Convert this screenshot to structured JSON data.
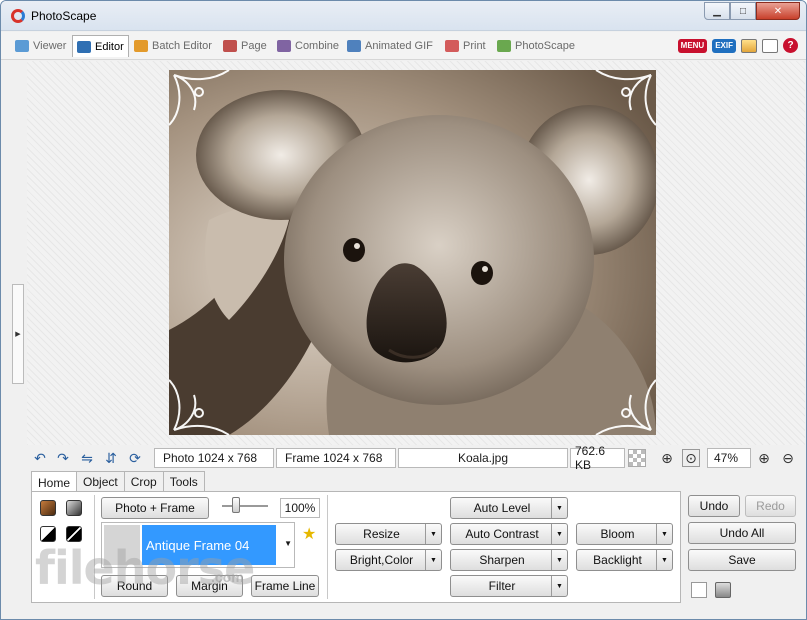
{
  "window": {
    "title": "PhotoScape"
  },
  "tabs": [
    {
      "label": "Viewer",
      "color": "#5b9bd5"
    },
    {
      "label": "Editor",
      "color": "#2f6fb3"
    },
    {
      "label": "Batch Editor",
      "color": "#e39a2b"
    },
    {
      "label": "Page",
      "color": "#c0504d"
    },
    {
      "label": "Combine",
      "color": "#8064a2"
    },
    {
      "label": "Animated GIF",
      "color": "#4f81bd"
    },
    {
      "label": "Print",
      "color": "#d35b5b"
    },
    {
      "label": "PhotoScape",
      "color": "#6aa84f"
    }
  ],
  "toolbar": {
    "menu_label": "MENU",
    "exif_label": "EXIF",
    "help_label": "?"
  },
  "status": {
    "photo_size": "Photo 1024 x 768",
    "frame_size": "Frame 1024 x 768",
    "filename": "Koala.jpg",
    "filesize": "762.6 KB",
    "zoom": "47%"
  },
  "panel_tabs": [
    "Home",
    "Object",
    "Crop",
    "Tools"
  ],
  "home": {
    "photo_frame_label": "Photo + Frame",
    "frame_percent": "100%",
    "frame_name": "Antique Frame 04",
    "round_label": "Round",
    "margin_label": "Margin",
    "frame_line_label": "Frame Line"
  },
  "adjust": {
    "resize": "Resize",
    "bright_color": "Bright,Color",
    "auto_level": "Auto Level",
    "auto_contrast": "Auto Contrast",
    "sharpen": "Sharpen",
    "filter": "Filter",
    "bloom": "Bloom",
    "backlight": "Backlight"
  },
  "history": {
    "undo": "Undo",
    "redo": "Redo",
    "undo_all": "Undo All",
    "save": "Save"
  },
  "watermark": {
    "brand": "filehorse",
    "suffix": ".com"
  }
}
